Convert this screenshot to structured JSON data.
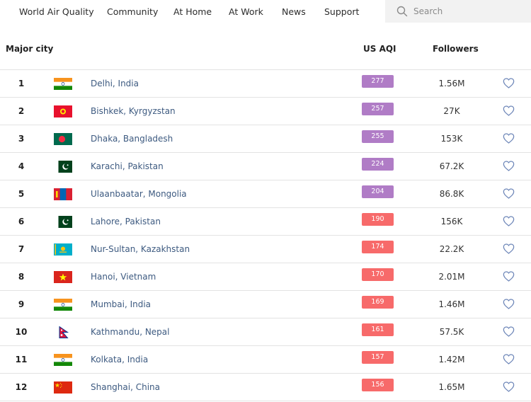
{
  "nav": {
    "items": [
      "World Air Quality",
      "Community",
      "At Home",
      "At Work",
      "News",
      "Support"
    ],
    "search_placeholder": "Search",
    "search_icon": "search-icon"
  },
  "table": {
    "headers": {
      "city": "Major city",
      "aqi": "US AQI",
      "followers": "Followers"
    },
    "aqi_colors": {
      "very_unhealthy": "#b07cc6",
      "unhealthy": "#f76a6a"
    },
    "rows": [
      {
        "rank": "1",
        "flag": "india",
        "city": "Delhi, India",
        "aqi": "277",
        "level": "very_unhealthy",
        "followers": "1.56M"
      },
      {
        "rank": "2",
        "flag": "kyrgyzstan",
        "city": "Bishkek, Kyrgyzstan",
        "aqi": "257",
        "level": "very_unhealthy",
        "followers": "27K"
      },
      {
        "rank": "3",
        "flag": "bangladesh",
        "city": "Dhaka, Bangladesh",
        "aqi": "255",
        "level": "very_unhealthy",
        "followers": "153K"
      },
      {
        "rank": "4",
        "flag": "pakistan",
        "city": "Karachi, Pakistan",
        "aqi": "224",
        "level": "very_unhealthy",
        "followers": "67.2K"
      },
      {
        "rank": "5",
        "flag": "mongolia",
        "city": "Ulaanbaatar, Mongolia",
        "aqi": "204",
        "level": "very_unhealthy",
        "followers": "86.8K"
      },
      {
        "rank": "6",
        "flag": "pakistan",
        "city": "Lahore, Pakistan",
        "aqi": "190",
        "level": "unhealthy",
        "followers": "156K"
      },
      {
        "rank": "7",
        "flag": "kazakhstan",
        "city": "Nur-Sultan, Kazakhstan",
        "aqi": "174",
        "level": "unhealthy",
        "followers": "22.2K"
      },
      {
        "rank": "8",
        "flag": "vietnam",
        "city": "Hanoi, Vietnam",
        "aqi": "170",
        "level": "unhealthy",
        "followers": "2.01M"
      },
      {
        "rank": "9",
        "flag": "india",
        "city": "Mumbai, India",
        "aqi": "169",
        "level": "unhealthy",
        "followers": "1.46M"
      },
      {
        "rank": "10",
        "flag": "nepal",
        "city": "Kathmandu, Nepal",
        "aqi": "161",
        "level": "unhealthy",
        "followers": "57.5K"
      },
      {
        "rank": "11",
        "flag": "india",
        "city": "Kolkata, India",
        "aqi": "157",
        "level": "unhealthy",
        "followers": "1.42M"
      },
      {
        "rank": "12",
        "flag": "china",
        "city": "Shanghai, China",
        "aqi": "156",
        "level": "unhealthy",
        "followers": "1.65M"
      }
    ]
  }
}
